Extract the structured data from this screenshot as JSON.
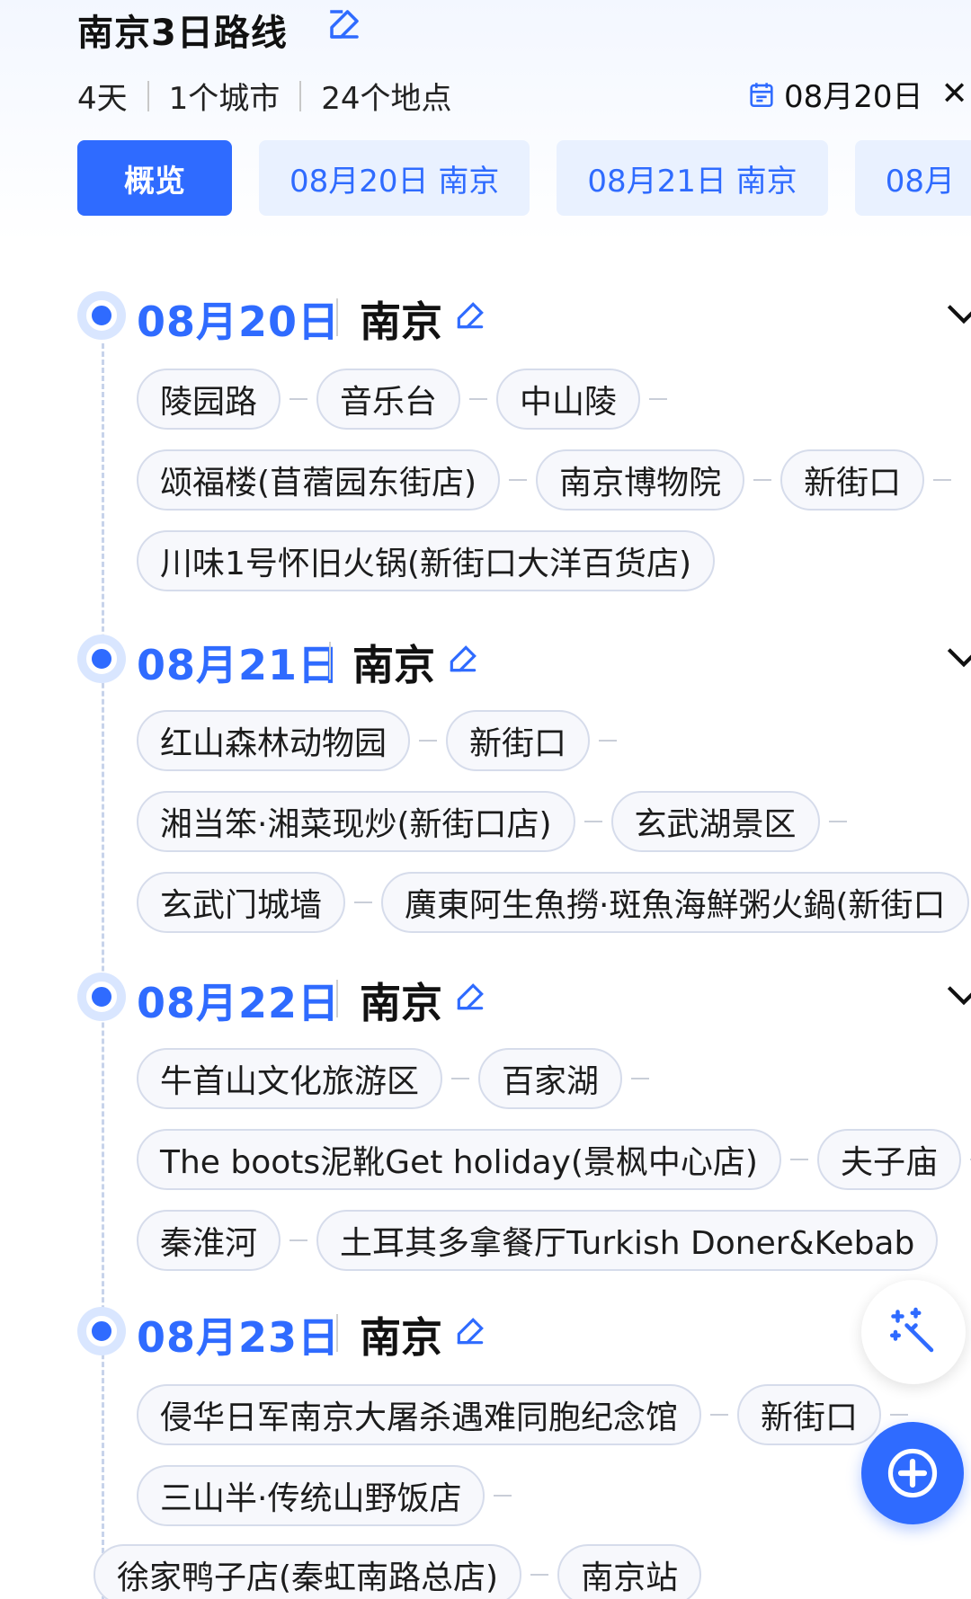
{
  "header": {
    "title": "南京3日路线",
    "meta": [
      "4天",
      "1个城市",
      "24个地点"
    ],
    "date": "08月20日"
  },
  "tabs": [
    "概览",
    "08月20日 南京",
    "08月21日 南京",
    "08月"
  ],
  "days": [
    {
      "date": "08月20日",
      "city": "南京",
      "rows": [
        [
          "陵园路",
          "音乐台",
          "中山陵"
        ],
        [
          "颂福楼(苜蓿园东街店)",
          "南京博物院",
          "新街口"
        ],
        [
          "川味1号怀旧火锅(新街口大洋百货店)"
        ]
      ]
    },
    {
      "date": "08月21日",
      "city": "南京",
      "rows": [
        [
          "红山森林动物园",
          "新街口"
        ],
        [
          "湘当笨·湘菜现炒(新街口店)",
          "玄武湖景区"
        ],
        [
          "玄武门城墙",
          "廣東阿生魚撈·斑魚海鮮粥火鍋(新街口"
        ]
      ]
    },
    {
      "date": "08月22日",
      "city": "南京",
      "rows": [
        [
          "牛首山文化旅游区",
          "百家湖"
        ],
        [
          "The boots泥靴Get holiday(景枫中心店)",
          "夫子庙"
        ],
        [
          "秦淮河",
          "土耳其多拿餐厅Turkish Doner&Kebab"
        ]
      ]
    },
    {
      "date": "08月23日",
      "city": "南京",
      "rows": [
        [
          "侵华日军南京大屠杀遇难同胞纪念馆",
          "新街口"
        ],
        [
          "三山半·传统山野饭店"
        ],
        [
          "徐家鸭子店(秦虹南路总店)",
          "南京站"
        ]
      ]
    }
  ],
  "icons": {
    "edit": "edit-icon",
    "calendar": "calendar-icon",
    "close": "close-icon",
    "chevron": "chevron-down-icon",
    "magic": "magic-wand-icon",
    "add": "plus-icon"
  },
  "colors": {
    "accent": "#2f6bff",
    "tab_bg": "#e9f1ff",
    "chip_bg": "#f7f8fc",
    "chip_border": "#d6dceb"
  }
}
